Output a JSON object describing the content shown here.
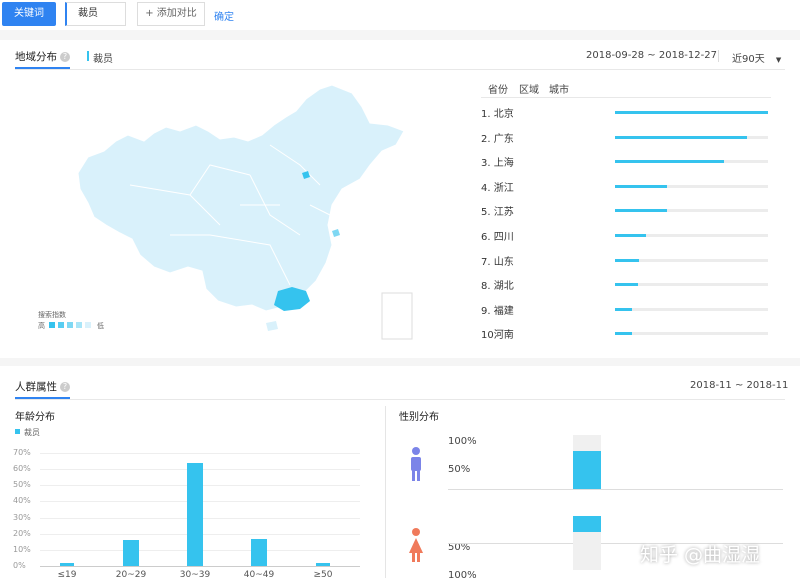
{
  "toolbar": {
    "keyword_button": "关键词",
    "keyword_value": "裁员",
    "add_compare": "+ 添加对比",
    "confirm": "确定"
  },
  "region": {
    "title": "地域分布",
    "legend_series": "裁员",
    "date_range": "2018-09-28 ~ 2018-12-27",
    "period_select": "近90天",
    "tabs": [
      "省份",
      "区域",
      "城市"
    ],
    "map_legend": {
      "title": "搜索指数",
      "high": "高",
      "low": "低"
    },
    "ranking": [
      {
        "label": "1. 北京",
        "value": 1.0
      },
      {
        "label": "2. 广东",
        "value": 0.86
      },
      {
        "label": "3. 上海",
        "value": 0.71
      },
      {
        "label": "4. 浙江",
        "value": 0.34
      },
      {
        "label": "5. 江苏",
        "value": 0.34
      },
      {
        "label": "6. 四川",
        "value": 0.2
      },
      {
        "label": "7. 山东",
        "value": 0.16
      },
      {
        "label": "8. 湖北",
        "value": 0.15
      },
      {
        "label": "9. 福建",
        "value": 0.11
      },
      {
        "label": "10河南",
        "value": 0.11
      }
    ],
    "colors": {
      "accent": "#2f83f1",
      "bar": "#35c3ee",
      "map_light": "#d9f1fb",
      "map_dark": "#35c3ee"
    }
  },
  "crowd": {
    "title": "人群属性",
    "date_range": "2018-11 ~ 2018-11",
    "age_title": "年龄分布",
    "gender_title": "性别分布",
    "legend_series": "裁员"
  },
  "chart_data": [
    {
      "type": "bar",
      "title": "年龄分布",
      "categories": [
        "≤19",
        "20~29",
        "30~39",
        "40~49",
        "≥50"
      ],
      "series": [
        {
          "name": "裁员",
          "values": [
            2,
            16,
            64,
            17,
            2
          ]
        }
      ],
      "y_ticks": [
        "70%",
        "60%",
        "50%",
        "40%",
        "30%",
        "20%",
        "10%",
        "0%"
      ],
      "ylim": [
        0,
        70
      ]
    },
    {
      "type": "bar",
      "title": "性别分布",
      "categories": [
        "男",
        "女"
      ],
      "values": [
        70,
        30
      ],
      "tick_labels": [
        "100%",
        "50%",
        "50%",
        "100%"
      ]
    }
  ],
  "watermark": "知乎 @曲湿湿"
}
